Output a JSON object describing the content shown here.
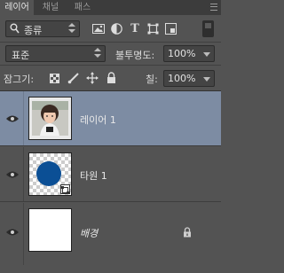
{
  "tabs": [
    {
      "label": "레이어",
      "active": true
    },
    {
      "label": "채널",
      "active": false
    },
    {
      "label": "패스",
      "active": false
    }
  ],
  "filter": {
    "kind_label": "종류",
    "icons": [
      "image-filter-icon",
      "adjustment-filter-icon",
      "type-filter-icon",
      "shape-filter-icon",
      "smart-object-filter-icon"
    ]
  },
  "blend": {
    "mode": "표준",
    "opacity_label": "불투명도:",
    "opacity_value": "100%"
  },
  "lock": {
    "label": "잠그기:",
    "fill_label": "칠:",
    "fill_value": "100%"
  },
  "layers": [
    {
      "name": "레이어 1",
      "selected": true,
      "italic": false,
      "locked": false
    },
    {
      "name": "타원 1",
      "selected": false,
      "italic": false,
      "locked": false
    },
    {
      "name": "배경",
      "selected": false,
      "italic": true,
      "locked": true
    }
  ],
  "colors": {
    "panel_bg": "#535353",
    "selected_layer": "#7d8ca3",
    "ellipse_fill": "#0b4f95"
  }
}
